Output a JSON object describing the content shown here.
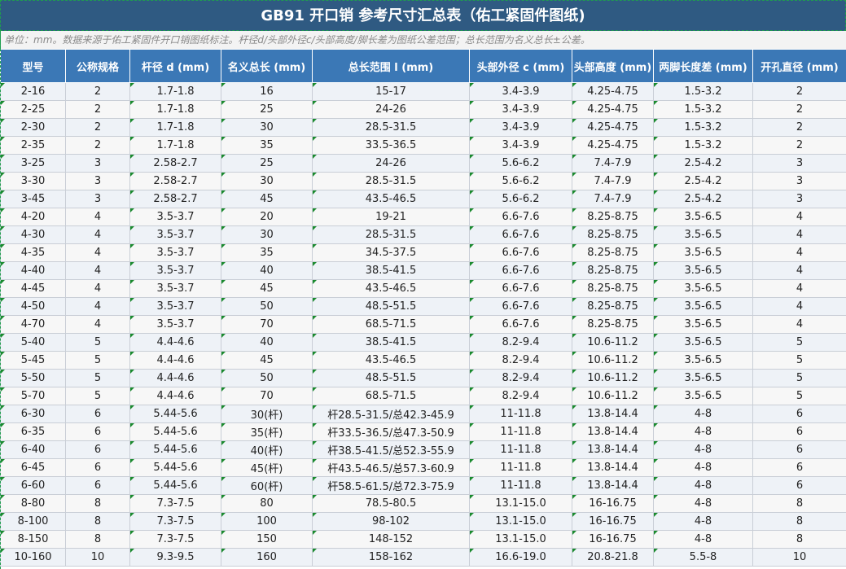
{
  "title": "GB91 开口销 参考尺寸汇总表（佑工紧固件图纸)",
  "note": "单位：mm。数据来源于佑工紧固件开口销图纸标注。杆径d/头部外径c/头部高度/脚长差为图纸公差范围；总长范围为名义总长±公差。",
  "columns": [
    "型号",
    "公称规格",
    "杆径 d (mm)",
    "名义总长 (mm)",
    "总长范围 l (mm)",
    "头部外径 c (mm)",
    "头部高度 (mm)",
    "两脚长度差 (mm)",
    "开孔直径 (mm)"
  ],
  "rows": [
    [
      "2-16",
      "2",
      "1.7-1.8",
      "16",
      "15-17",
      "3.4-3.9",
      "4.25-4.75",
      "1.5-3.2",
      "2"
    ],
    [
      "2-25",
      "2",
      "1.7-1.8",
      "25",
      "24-26",
      "3.4-3.9",
      "4.25-4.75",
      "1.5-3.2",
      "2"
    ],
    [
      "2-30",
      "2",
      "1.7-1.8",
      "30",
      "28.5-31.5",
      "3.4-3.9",
      "4.25-4.75",
      "1.5-3.2",
      "2"
    ],
    [
      "2-35",
      "2",
      "1.7-1.8",
      "35",
      "33.5-36.5",
      "3.4-3.9",
      "4.25-4.75",
      "1.5-3.2",
      "2"
    ],
    [
      "3-25",
      "3",
      "2.58-2.7",
      "25",
      "24-26",
      "5.6-6.2",
      "7.4-7.9",
      "2.5-4.2",
      "3"
    ],
    [
      "3-30",
      "3",
      "2.58-2.7",
      "30",
      "28.5-31.5",
      "5.6-6.2",
      "7.4-7.9",
      "2.5-4.2",
      "3"
    ],
    [
      "3-45",
      "3",
      "2.58-2.7",
      "45",
      "43.5-46.5",
      "5.6-6.2",
      "7.4-7.9",
      "2.5-4.2",
      "3"
    ],
    [
      "4-20",
      "4",
      "3.5-3.7",
      "20",
      "19-21",
      "6.6-7.6",
      "8.25-8.75",
      "3.5-6.5",
      "4"
    ],
    [
      "4-30",
      "4",
      "3.5-3.7",
      "30",
      "28.5-31.5",
      "6.6-7.6",
      "8.25-8.75",
      "3.5-6.5",
      "4"
    ],
    [
      "4-35",
      "4",
      "3.5-3.7",
      "35",
      "34.5-37.5",
      "6.6-7.6",
      "8.25-8.75",
      "3.5-6.5",
      "4"
    ],
    [
      "4-40",
      "4",
      "3.5-3.7",
      "40",
      "38.5-41.5",
      "6.6-7.6",
      "8.25-8.75",
      "3.5-6.5",
      "4"
    ],
    [
      "4-45",
      "4",
      "3.5-3.7",
      "45",
      "43.5-46.5",
      "6.6-7.6",
      "8.25-8.75",
      "3.5-6.5",
      "4"
    ],
    [
      "4-50",
      "4",
      "3.5-3.7",
      "50",
      "48.5-51.5",
      "6.6-7.6",
      "8.25-8.75",
      "3.5-6.5",
      "4"
    ],
    [
      "4-70",
      "4",
      "3.5-3.7",
      "70",
      "68.5-71.5",
      "6.6-7.6",
      "8.25-8.75",
      "3.5-6.5",
      "4"
    ],
    [
      "5-40",
      "5",
      "4.4-4.6",
      "40",
      "38.5-41.5",
      "8.2-9.4",
      "10.6-11.2",
      "3.5-6.5",
      "5"
    ],
    [
      "5-45",
      "5",
      "4.4-4.6",
      "45",
      "43.5-46.5",
      "8.2-9.4",
      "10.6-11.2",
      "3.5-6.5",
      "5"
    ],
    [
      "5-50",
      "5",
      "4.4-4.6",
      "50",
      "48.5-51.5",
      "8.2-9.4",
      "10.6-11.2",
      "3.5-6.5",
      "5"
    ],
    [
      "5-70",
      "5",
      "4.4-4.6",
      "70",
      "68.5-71.5",
      "8.2-9.4",
      "10.6-11.2",
      "3.5-6.5",
      "5"
    ],
    [
      "6-30",
      "6",
      "5.44-5.6",
      "30(杆)",
      "杆28.5-31.5/总42.3-45.9",
      "11-11.8",
      "13.8-14.4",
      "4-8",
      "6"
    ],
    [
      "6-35",
      "6",
      "5.44-5.6",
      "35(杆)",
      "杆33.5-36.5/总47.3-50.9",
      "11-11.8",
      "13.8-14.4",
      "4-8",
      "6"
    ],
    [
      "6-40",
      "6",
      "5.44-5.6",
      "40(杆)",
      "杆38.5-41.5/总52.3-55.9",
      "11-11.8",
      "13.8-14.4",
      "4-8",
      "6"
    ],
    [
      "6-45",
      "6",
      "5.44-5.6",
      "45(杆)",
      "杆43.5-46.5/总57.3-60.9",
      "11-11.8",
      "13.8-14.4",
      "4-8",
      "6"
    ],
    [
      "6-60",
      "6",
      "5.44-5.6",
      "60(杆)",
      "杆58.5-61.5/总72.3-75.9",
      "11-11.8",
      "13.8-14.4",
      "4-8",
      "6"
    ],
    [
      "8-80",
      "8",
      "7.3-7.5",
      "80",
      "78.5-80.5",
      "13.1-15.0",
      "16-16.75",
      "4-8",
      "8"
    ],
    [
      "8-100",
      "8",
      "7.3-7.5",
      "100",
      "98-102",
      "13.1-15.0",
      "16-16.75",
      "4-8",
      "8"
    ],
    [
      "8-150",
      "8",
      "7.3-7.5",
      "150",
      "148-152",
      "13.1-15.0",
      "16-16.75",
      "4-8",
      "8"
    ],
    [
      "10-160",
      "10",
      "9.3-9.5",
      "160",
      "158-162",
      "16.6-19.0",
      "20.8-21.8",
      "5.5-8",
      "10"
    ]
  ],
  "text_columns": [
    0,
    2,
    3,
    4,
    5,
    6,
    7
  ],
  "colors": {
    "title_bg": "#2f5a82",
    "header_bg": "#3b78b6",
    "row_odd": "#eef2f7",
    "row_even": "#f7f7f7",
    "text_marker": "#1a8a2e"
  }
}
